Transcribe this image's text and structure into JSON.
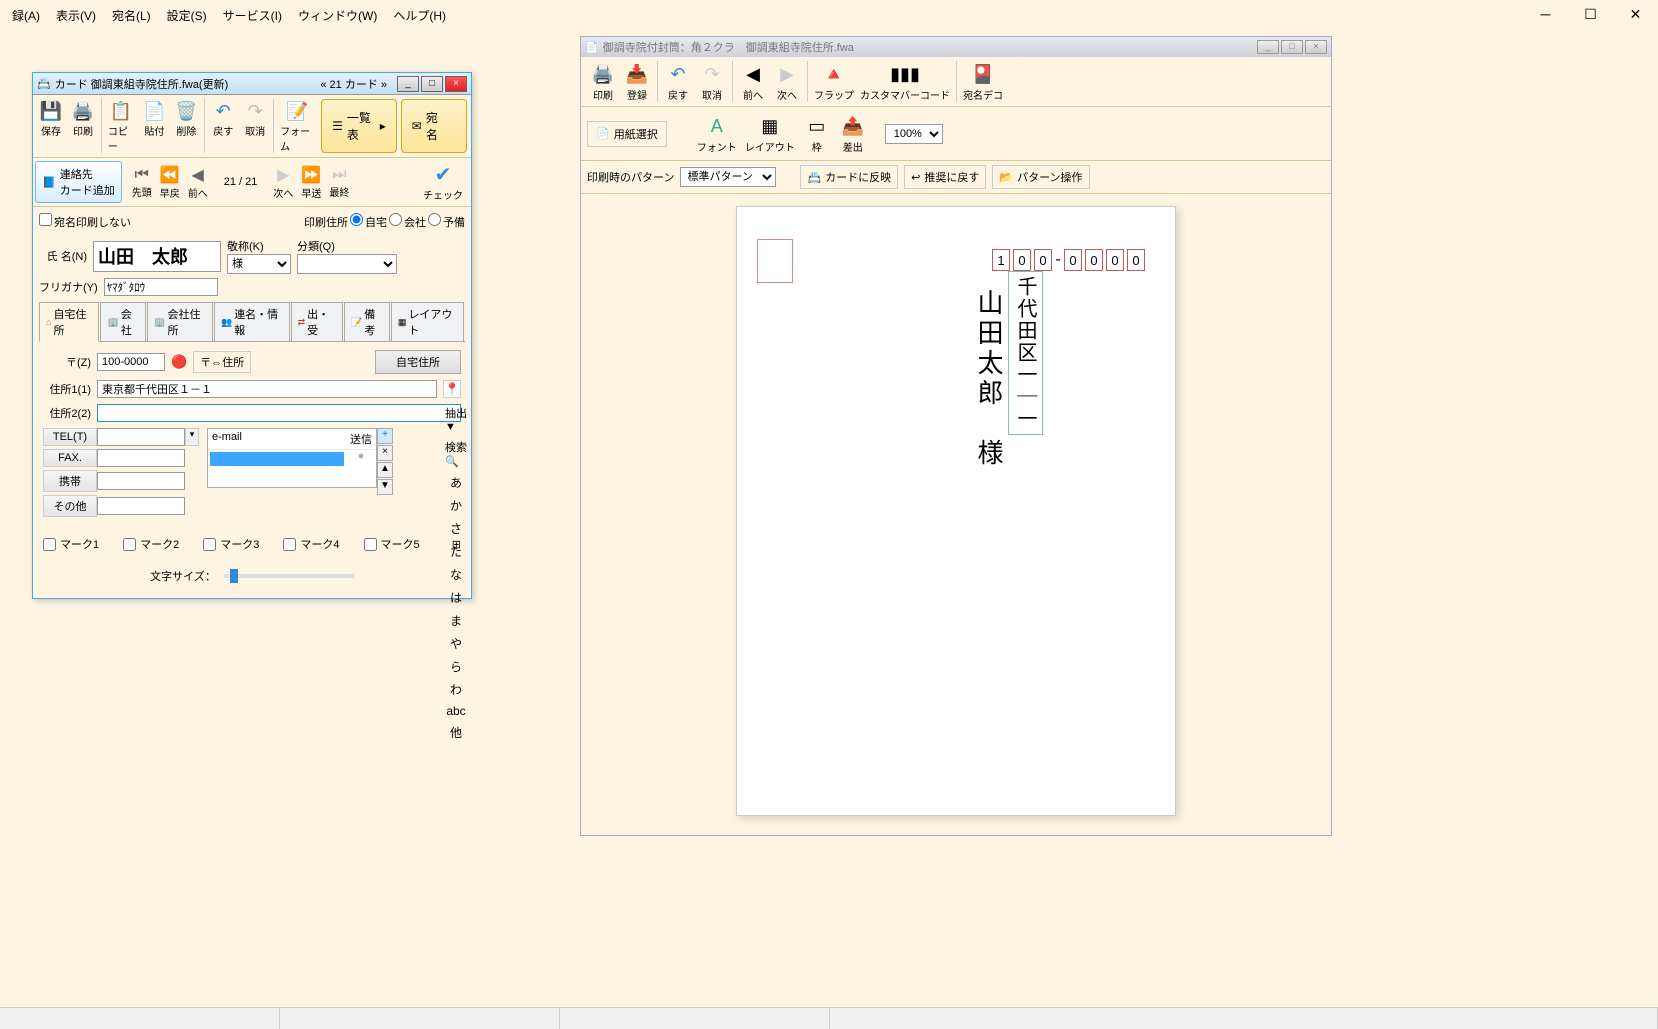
{
  "menu": {
    "roku": "録(A)",
    "view": "表示(V)",
    "atena": "宛名(L)",
    "settings": "設定(S)",
    "service": "サービス(I)",
    "window": "ウィンドウ(W)",
    "help": "ヘルプ(H)"
  },
  "card": {
    "title": "カード 御調東組寺院住所.fwa(更新)",
    "count": "« 21 カード »",
    "tb1": {
      "save": "保存",
      "print": "印刷",
      "copy": "コピー",
      "paste": "貼付",
      "delete": "削除",
      "undo": "戻す",
      "redo": "取消",
      "form": "フォーム",
      "list": "一覧表",
      "atena": "宛　名"
    },
    "tb2": {
      "contact_add": "連絡先\nカード追加",
      "first": "先頭",
      "prevfast": "早戻",
      "prev": "前へ",
      "page": "21 /    21",
      "next": "次へ",
      "nextfast": "早送",
      "last": "最終",
      "check": "チェック"
    },
    "print_opts": {
      "noprint": "宛名印刷しない",
      "print_addr": "印刷住所",
      "home": "自宅",
      "office": "会社",
      "spare": "予備"
    },
    "labels": {
      "name": "氏  名(N)",
      "honorific": "敬称(K)",
      "category": "分類(Q)",
      "kana": "フリガナ(Y)"
    },
    "name_value": "山田　太郎",
    "honorific_value": "様",
    "kana_value": "ﾔﾏﾀﾞﾀﾛｳ",
    "tabs": {
      "home": "自宅住所",
      "office": "会社",
      "office_addr": "会社住所",
      "joint": "連名・情報",
      "sent": "出・受",
      "memo": "備考",
      "layout": "レイアウト"
    },
    "addr": {
      "zip_label": "〒(Z)",
      "zip_value": "100-0000",
      "zip_btn": "〒⇔住所",
      "home_btn": "自宅住所",
      "addr1_label": "住所1(1)",
      "addr1_value": "東京都千代田区１－１",
      "addr2_label": "住所2(2)",
      "addr2_value": ""
    },
    "contacts": {
      "tel": "TEL(T)",
      "fax": "FAX.",
      "mobile": "携帯",
      "other": "その他"
    },
    "email": {
      "head": "e-mail",
      "send": "送信"
    },
    "marks": {
      "m1": "マーク1",
      "m2": "マーク2",
      "m3": "マーク3",
      "m4": "マーク4",
      "m5": "マーク5"
    },
    "fontsize": "文字サイズ：",
    "index": {
      "extract": "抽出",
      "search": "検索",
      "a": "あ",
      "ka": "か",
      "sa": "さ",
      "ta": "た",
      "na": "な",
      "ha": "は",
      "ma": "ま",
      "ya": "や",
      "ra": "ら",
      "wa": "わ",
      "abc": "abc",
      "other": "他"
    }
  },
  "preview": {
    "title": "御調寺院付封筒：角２クラ　御調東組寺院住所.fwa",
    "tb1": {
      "print": "印刷",
      "register": "登録",
      "undo": "戻す",
      "redo": "取消",
      "prev": "前へ",
      "next": "次へ",
      "flap": "フラップ",
      "barcode": "カスタマバーコード",
      "deco": "宛名デコ"
    },
    "tb2": {
      "paper": "用紙選択",
      "font": "フォント",
      "layout": "レイアウト",
      "frame": "枠",
      "diff": "差出",
      "zoom": "100%"
    },
    "tb3": {
      "pattern_label": "印刷時のパターン",
      "pattern_value": "標準パターン",
      "reflect": "カードに反映",
      "restore": "推奨に戻す",
      "pattern_ops": "パターン操作"
    },
    "postal": [
      "1",
      "0",
      "0",
      "0",
      "0",
      "0",
      "0"
    ],
    "address": "千代田区一｜一",
    "recipient": "山田太郎　様"
  }
}
